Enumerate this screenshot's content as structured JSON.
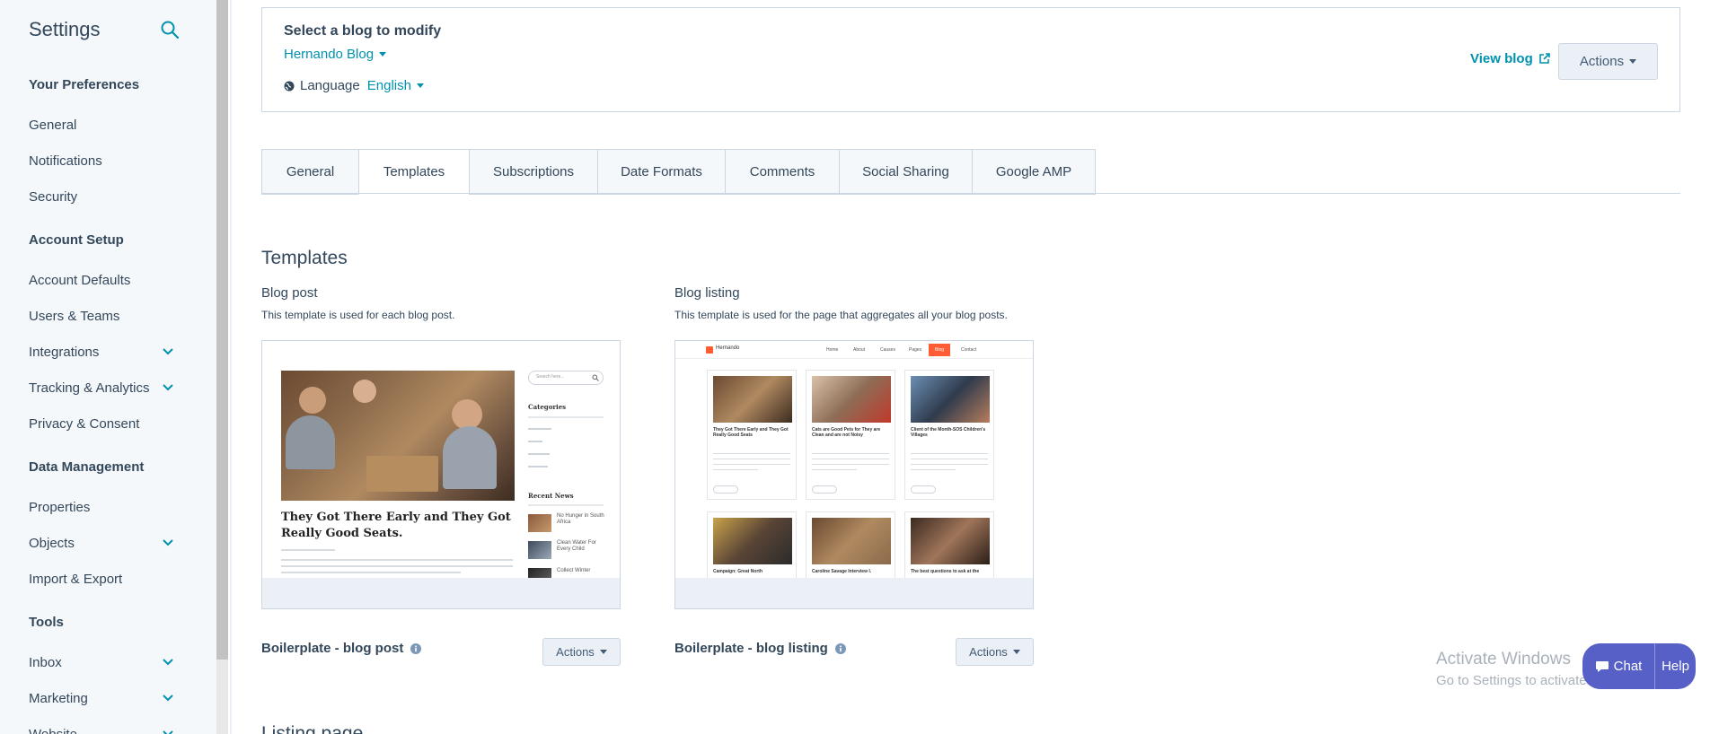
{
  "sidebar": {
    "title": "Settings",
    "sections": [
      {
        "heading": "Your Preferences",
        "items": [
          {
            "label": "General",
            "expandable": false
          },
          {
            "label": "Notifications",
            "expandable": false
          },
          {
            "label": "Security",
            "expandable": false
          }
        ]
      },
      {
        "heading": "Account Setup",
        "items": [
          {
            "label": "Account Defaults",
            "expandable": false
          },
          {
            "label": "Users & Teams",
            "expandable": false
          },
          {
            "label": "Integrations",
            "expandable": true
          },
          {
            "label": "Tracking & Analytics",
            "expandable": true
          },
          {
            "label": "Privacy & Consent",
            "expandable": false
          }
        ]
      },
      {
        "heading": "Data Management",
        "items": [
          {
            "label": "Properties",
            "expandable": false
          },
          {
            "label": "Objects",
            "expandable": true
          },
          {
            "label": "Import & Export",
            "expandable": false
          }
        ]
      },
      {
        "heading": "Tools",
        "items": [
          {
            "label": "Inbox",
            "expandable": true
          },
          {
            "label": "Marketing",
            "expandable": true
          },
          {
            "label": "Website",
            "expandable": true
          }
        ]
      }
    ]
  },
  "blog_card": {
    "heading": "Select a blog to modify",
    "selected_blog": "Hernando Blog",
    "language_label": "Language",
    "selected_language": "English",
    "view_blog": "View blog",
    "actions": "Actions"
  },
  "tabs": [
    {
      "label": "General",
      "active": false
    },
    {
      "label": "Templates",
      "active": true
    },
    {
      "label": "Subscriptions",
      "active": false
    },
    {
      "label": "Date Formats",
      "active": false
    },
    {
      "label": "Comments",
      "active": false
    },
    {
      "label": "Social Sharing",
      "active": false
    },
    {
      "label": "Google AMP",
      "active": false
    }
  ],
  "templates": {
    "title": "Templates",
    "blog_post": {
      "title": "Blog post",
      "description": "This template is used for each blog post.",
      "name": "Boilerplate - blog post",
      "actions": "Actions",
      "preview": {
        "headline": "They Got There Early and They Got Really Good Seats.",
        "search_placeholder": "Search here...",
        "categories_heading": "Categories",
        "recent_news_heading": "Recent News",
        "recent_news": [
          "No Hunger in South Africa",
          "Clean Water For Every Child",
          "Collect Winter"
        ]
      }
    },
    "blog_listing": {
      "title": "Blog listing",
      "description": "This template is used for the page that aggregates all your blog posts.",
      "name": "Boilerplate - blog listing",
      "actions": "Actions",
      "preview": {
        "logo_text": "Hernando",
        "nav": [
          "Home",
          "About",
          "Causes",
          "Pages",
          "Blog",
          "Contact"
        ],
        "posts": [
          "They Got There Early and They Got Really Good Seats",
          "Cats are Good Pets for They are Clean and are not Noisy",
          "Client of the Month-SOS Children's Villages",
          "Campaign: Great North",
          "Caroline Savage Interview I.",
          "The best questions to ask at the"
        ],
        "read_more": "Read More"
      }
    }
  },
  "next_section_title": "Listing page",
  "watermark": {
    "line1": "Activate Windows",
    "line2": "Go to Settings to activate Windows."
  },
  "chat": {
    "chat_label": "Chat",
    "help_label": "Help"
  },
  "colors": {
    "link": "#0091ae",
    "text": "#33475b",
    "sidebar_bg": "#f5f8fa",
    "border": "#cbd6e2",
    "chat_bg": "#5660c6",
    "accent_orange": "#ff5c35"
  }
}
